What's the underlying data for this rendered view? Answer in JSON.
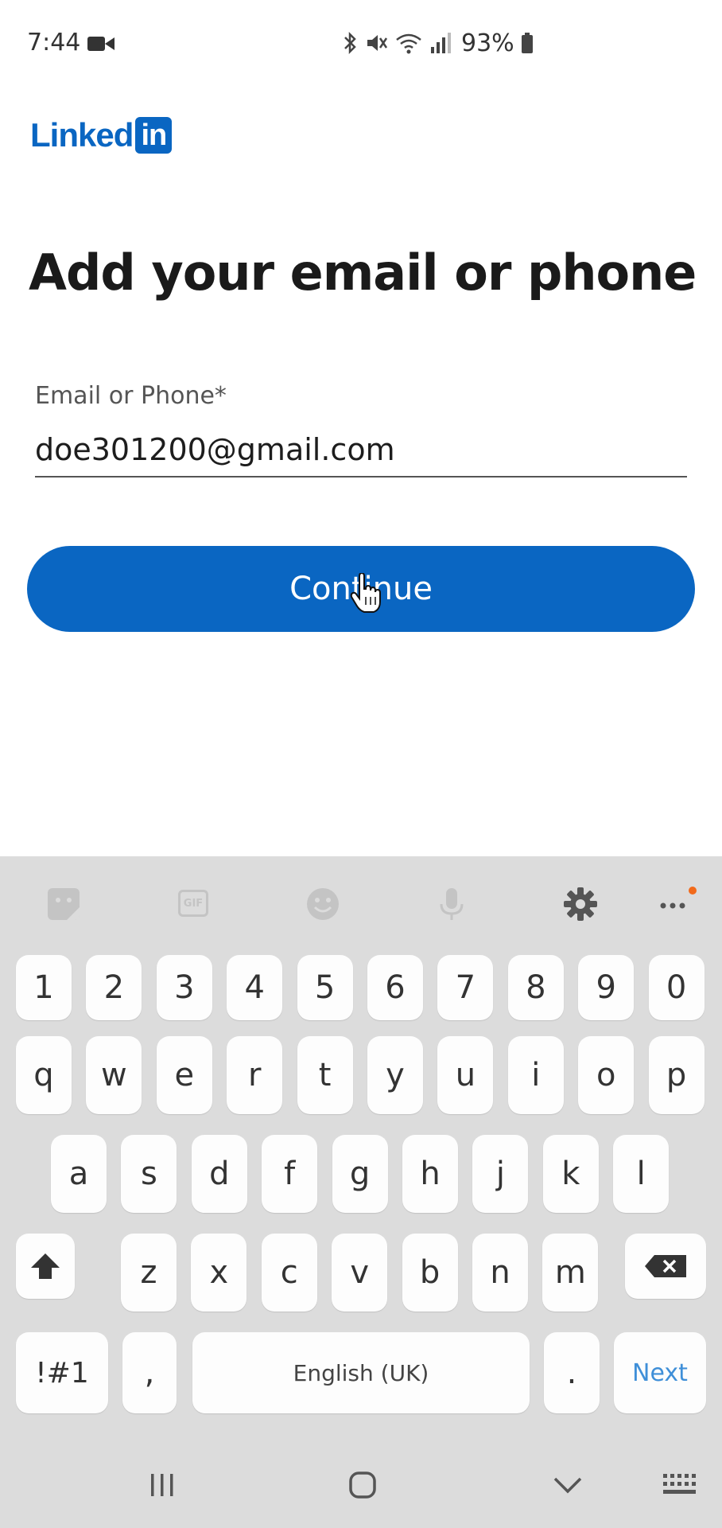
{
  "status_bar": {
    "time": "7:44",
    "battery": "93%"
  },
  "header": {
    "logo_text": "Linked",
    "logo_box_text": "in",
    "brand_color": "#0a66c2"
  },
  "main": {
    "title": "Add your email or phone",
    "field_label": "Email or Phone*",
    "email_value": "doe301200@gmail.com",
    "continue_label": "Continue"
  },
  "keyboard": {
    "toolbar": [
      "sticker-icon",
      "gif-icon",
      "emoji-icon",
      "microphone-icon",
      "gear-icon",
      "more-icon"
    ],
    "gif_label": "GIF",
    "number_row": [
      "1",
      "2",
      "3",
      "4",
      "5",
      "6",
      "7",
      "8",
      "9",
      "0"
    ],
    "row1": [
      "q",
      "w",
      "e",
      "r",
      "t",
      "y",
      "u",
      "i",
      "o",
      "p"
    ],
    "row2": [
      "a",
      "s",
      "d",
      "f",
      "g",
      "h",
      "j",
      "k",
      "l"
    ],
    "row3": [
      "z",
      "x",
      "c",
      "v",
      "b",
      "n",
      "m"
    ],
    "symbols_label": "!#1",
    "comma_label": ",",
    "space_label": "English (UK)",
    "period_label": ".",
    "next_label": "Next"
  },
  "colors": {
    "keyboard_bg": "#dcdcdc",
    "key_bg": "#fdfdfd",
    "next_text": "#3f8fd8",
    "notification_dot": "#f26a1b"
  }
}
